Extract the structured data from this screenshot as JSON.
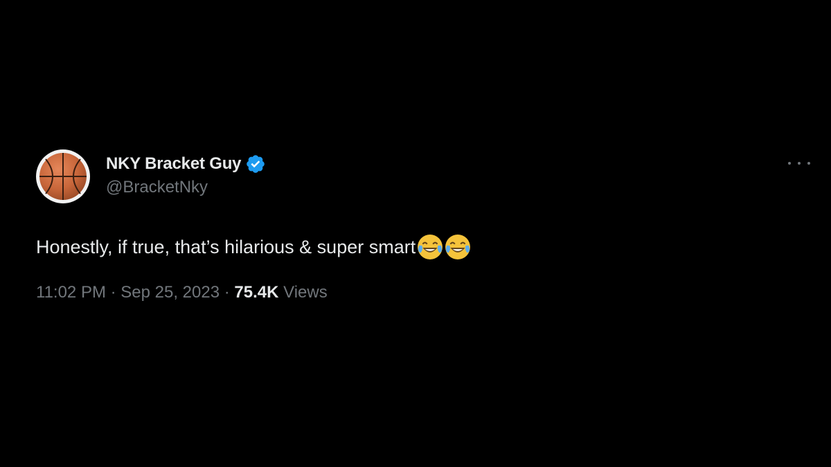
{
  "tweet": {
    "author": {
      "display_name": "NKY Bracket Guy",
      "handle": "@BracketNky",
      "avatar_icon": "basketball-icon",
      "verified_icon": "verified-badge-icon",
      "verified_color": "#1d9bf0"
    },
    "text": "Honestly, if true, that’s hilarious & super smart",
    "emojis": [
      "face-with-tears-of-joy-icon",
      "face-with-tears-of-joy-icon"
    ],
    "time": "11:02 PM",
    "separator": " · ",
    "date": "Sep 25, 2023",
    "views_count": "75.4K",
    "views_label": " Views",
    "more_icon": "more-options-icon"
  },
  "colors": {
    "background": "#000000",
    "primary_text": "#e7e9ea",
    "secondary_text": "#71767b"
  }
}
